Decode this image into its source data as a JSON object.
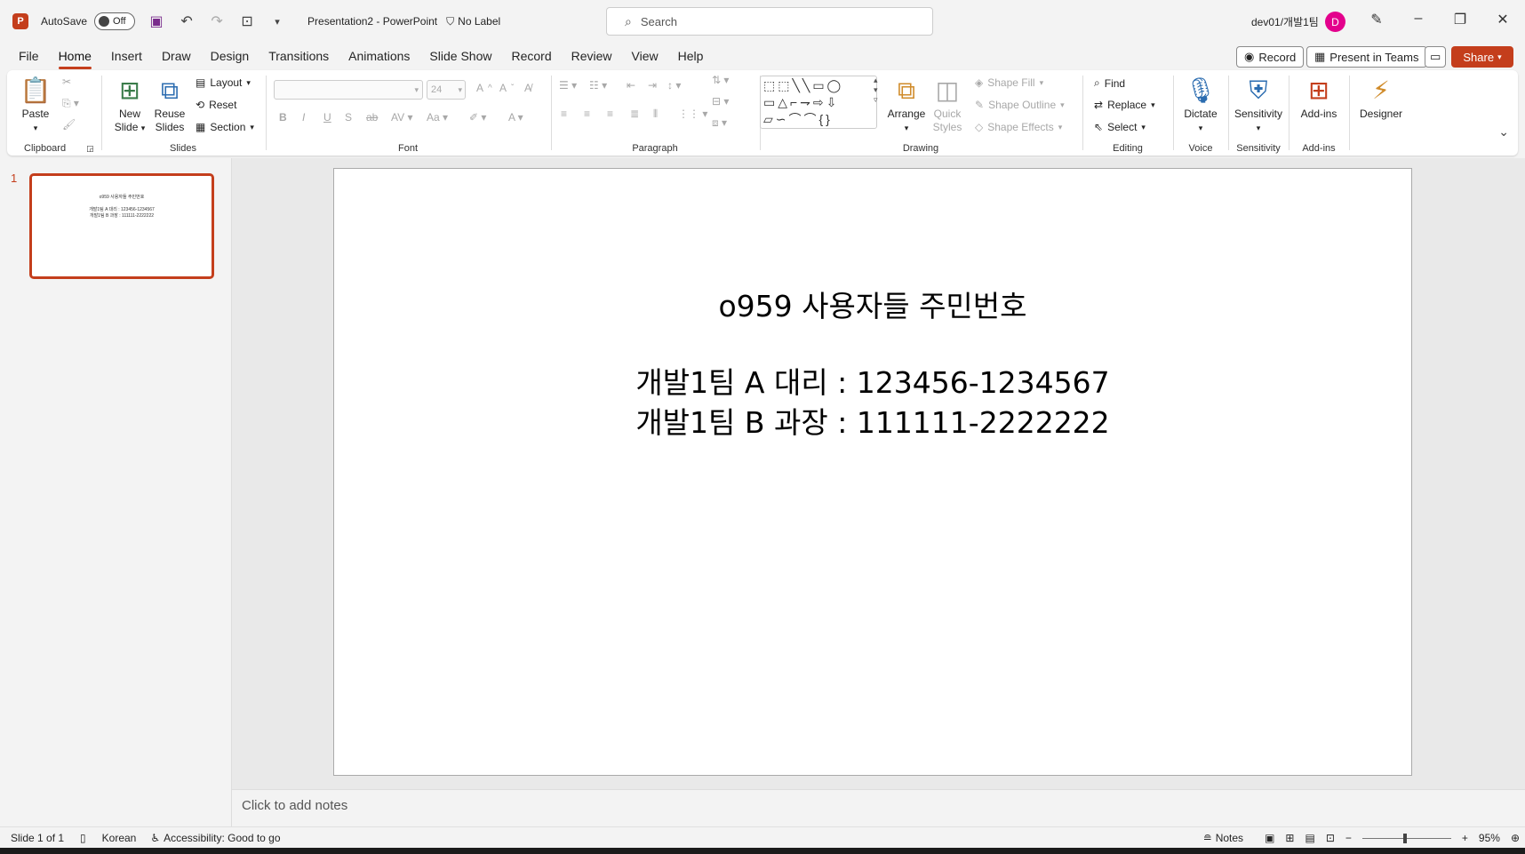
{
  "titlebar": {
    "app_icon": "P",
    "autosave_label": "AutoSave",
    "autosave_state": "Off",
    "doc_title": "Presentation2  -  PowerPoint",
    "label": "No Label",
    "search_placeholder": "Search",
    "user": "dev01/개발1팀",
    "avatar_initial": "D"
  },
  "menu": {
    "tabs": [
      "File",
      "Home",
      "Insert",
      "Draw",
      "Design",
      "Transitions",
      "Animations",
      "Slide Show",
      "Record",
      "Review",
      "View",
      "Help"
    ],
    "active": "Home",
    "record_btn": "Record",
    "present_btn": "Present in Teams",
    "share_btn": "Share"
  },
  "ribbon": {
    "clipboard": {
      "label": "Clipboard",
      "paste": "Paste"
    },
    "slides": {
      "label": "Slides",
      "new_slide": "New Slide",
      "reuse_slides": "Reuse Slides",
      "layout": "Layout",
      "reset": "Reset",
      "section": "Section"
    },
    "font": {
      "label": "Font",
      "size": "24"
    },
    "paragraph": {
      "label": "Paragraph"
    },
    "drawing": {
      "label": "Drawing",
      "arrange": "Arrange",
      "quick_styles": "Quick Styles",
      "shape_fill": "Shape Fill",
      "shape_outline": "Shape Outline",
      "shape_effects": "Shape Effects"
    },
    "editing": {
      "label": "Editing",
      "find": "Find",
      "replace": "Replace",
      "select": "Select"
    },
    "voice": {
      "label": "Voice",
      "dictate": "Dictate"
    },
    "sensitivity": {
      "label": "Sensitivity",
      "btn": "Sensitivity"
    },
    "addins": {
      "label": "Add-ins",
      "btn": "Add-ins"
    },
    "designer": {
      "btn": "Designer"
    }
  },
  "thumbnail": {
    "number": "1",
    "title": "o959 사용자들 주민번호",
    "line1": "개발1팀 A 대리 : 123456-1234567",
    "line2": "개발1팀 B 과장 : 111111-2222222"
  },
  "slide": {
    "title": "o959 사용자들 주민번호",
    "line1": "개발1팀 A 대리 : 123456-1234567",
    "line2": "개발1팀 B 과장 : 111111-2222222"
  },
  "notes_placeholder": "Click to add notes",
  "status": {
    "slide_count": "Slide 1 of 1",
    "language": "Korean",
    "accessibility": "Accessibility: Good to go",
    "notes": "Notes",
    "zoom": "95%"
  }
}
